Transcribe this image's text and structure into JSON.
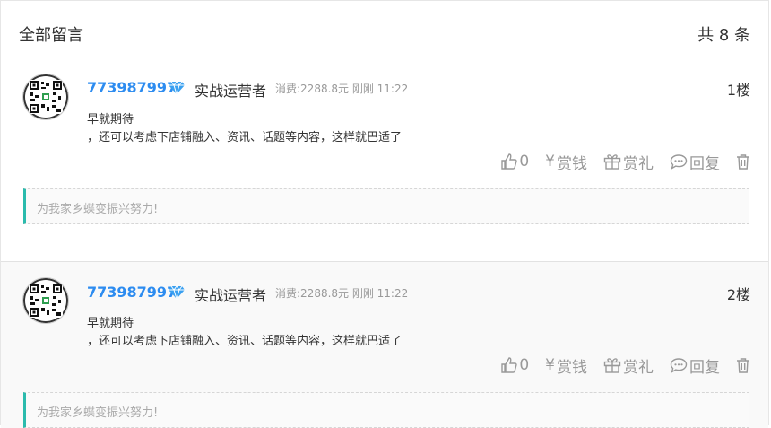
{
  "header": {
    "title": "全部留言",
    "count": "共 8 条"
  },
  "comments": [
    {
      "username": "773987997",
      "role": "实战运营者",
      "meta": "消费:2288.8元 刚刚 11:22",
      "floor": "1楼",
      "line1": "早就期待",
      "line2": "，还可以考虑下店铺融入、资讯、话题等内容，这样就巴适了",
      "like_count": "0",
      "reward_label": "赏钱",
      "gift_label": "赏礼",
      "reply_label": "回复",
      "note": "为我家乡蝶变振兴努力!"
    },
    {
      "username": "773987997",
      "role": "实战运营者",
      "meta": "消费:2288.8元 刚刚 11:22",
      "floor": "2楼",
      "line1": "早就期待",
      "line2": "，还可以考虑下店铺融入、资讯、话题等内容，这样就巴适了",
      "like_count": "0",
      "reward_label": "赏钱",
      "gift_label": "赏礼",
      "reply_label": "回复",
      "note": "为我家乡蝶变振兴努力!"
    }
  ],
  "icons": {
    "avatar": "qr-code-avatar",
    "vip": "diamond-icon",
    "like": "thumbs-up-icon",
    "reward": "yen-icon",
    "gift": "gift-icon",
    "reply": "speech-bubble-icon",
    "delete": "trash-icon"
  },
  "colors": {
    "username": "#2d8cf0",
    "note_accent": "#2bbbad",
    "action": "#999999"
  }
}
